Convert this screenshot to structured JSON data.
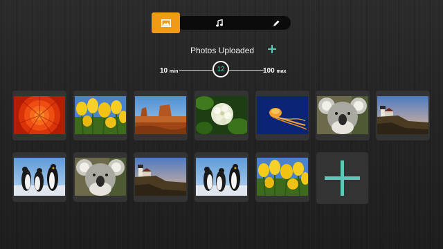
{
  "tabs": {
    "items": [
      {
        "name": "photos",
        "icon": "image-icon",
        "active": true
      },
      {
        "name": "music",
        "icon": "music-note-icon",
        "active": false
      },
      {
        "name": "edit",
        "icon": "pencil-icon",
        "active": false
      }
    ],
    "accent_color": "#f19a16"
  },
  "header": {
    "title": "Photos Uploaded",
    "add_icon": "plus-icon",
    "accent_color": "#5ec8b8"
  },
  "slider": {
    "min_value": "10",
    "min_unit": "min",
    "max_value": "100",
    "max_unit": "max",
    "current": "12"
  },
  "photos": [
    {
      "subject": "chrysanthemum"
    },
    {
      "subject": "tulips"
    },
    {
      "subject": "desert"
    },
    {
      "subject": "hydrangeas"
    },
    {
      "subject": "jellyfish"
    },
    {
      "subject": "koala"
    },
    {
      "subject": "lighthouse"
    },
    {
      "subject": "penguins"
    },
    {
      "subject": "koala"
    },
    {
      "subject": "lighthouse"
    },
    {
      "subject": "penguins"
    },
    {
      "subject": "tulips"
    }
  ],
  "add_photo_icon": "plus-icon"
}
